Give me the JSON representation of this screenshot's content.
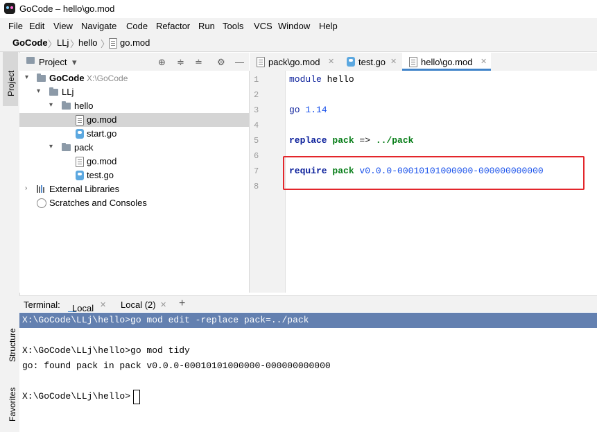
{
  "window": {
    "title": "GoCode – hello\\go.mod"
  },
  "menu": [
    "File",
    "Edit",
    "View",
    "Navigate",
    "Code",
    "Refactor",
    "Run",
    "Tools",
    "VCS",
    "Window",
    "Help"
  ],
  "breadcrumb": [
    "GoCode",
    "LLj",
    "hello",
    "go.mod"
  ],
  "left_stripe": {
    "project_tab": "Project",
    "structure_tab": "Structure",
    "favorites_tab": "Favorites"
  },
  "project_panel": {
    "header": "Project",
    "tree": [
      {
        "label": "GoCode",
        "hint": "X:\\GoCode"
      },
      {
        "label": "LLj"
      },
      {
        "label": "hello"
      },
      {
        "label": "go.mod"
      },
      {
        "label": "start.go"
      },
      {
        "label": "pack"
      },
      {
        "label": "go.mod"
      },
      {
        "label": "test.go"
      },
      {
        "label": "External Libraries"
      },
      {
        "label": "Scratches and Consoles"
      }
    ]
  },
  "editor": {
    "tabs": [
      {
        "label": "pack\\go.mod"
      },
      {
        "label": "test.go"
      },
      {
        "label": "hello\\go.mod"
      }
    ],
    "line_numbers": [
      "1",
      "2",
      "3",
      "4",
      "5",
      "6",
      "7",
      "8"
    ],
    "code": {
      "l1_kw": "module",
      "l1_rest": " hello",
      "l3_kw": "go",
      "l3_ver": " 1.14",
      "l5_kw": "replace",
      "l5_pkg": " pack",
      "l5_op": " => ",
      "l5_path": "../pack",
      "l7_kw": "require",
      "l7_pkg": " pack",
      "l7_ver": " v0.0.0-00010101000000-000000000000"
    }
  },
  "terminal": {
    "label": "Terminal:",
    "tabs": [
      "Local",
      "Local (2)"
    ],
    "add": "+",
    "lines": {
      "cmd1": "X:\\GoCode\\LLj\\hello>go mod edit -replace pack=../pack",
      "prompt2": "X:\\GoCode\\LLj\\hello>",
      "cmd2": "go mod tidy",
      "out": "go: found pack in pack v0.0.0-00010101000000-000000000000",
      "prompt3": "X:\\GoCode\\LLj\\hello>"
    }
  }
}
